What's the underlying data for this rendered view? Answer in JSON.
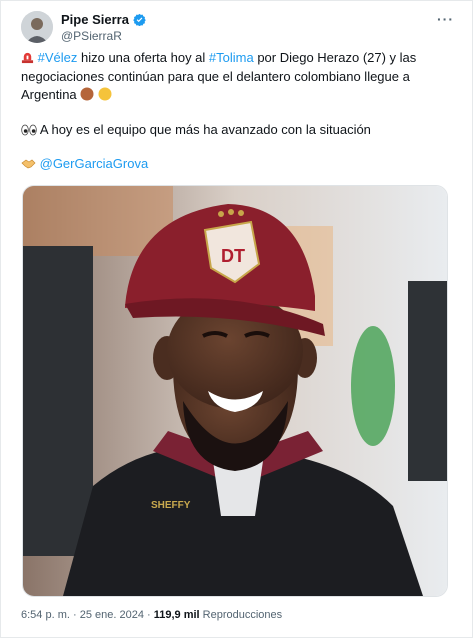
{
  "author": {
    "name": "Pipe Sierra",
    "handle": "@PSierraR"
  },
  "menu": {
    "more_label": "···"
  },
  "tweet": {
    "line1": {
      "hashtag1": "#Vélez",
      "text1": " hizo una oferta hoy al ",
      "hashtag2": "#Tolima",
      "text2": " por Diego Herazo (27) y las negociaciones continúan para que el delantero colombiano llegue a Argentina "
    },
    "line2": {
      "text": " A hoy es el equipo que más ha avanzado con la situación"
    },
    "line3": {
      "mention": "@GerGarciaGrova"
    }
  },
  "photo": {
    "cap_text": "DT",
    "jacket_text": "SHEFFY"
  },
  "meta": {
    "time": "6:54 p. m.",
    "sep1": " · ",
    "date": "25 ene. 2024",
    "sep2": " · ",
    "views": "119,9 mil",
    "views_label": " Reproducciones"
  },
  "colors": {
    "link": "#1d9bf0",
    "verified": "#1d9bf0",
    "cap": "#8a1f2c"
  }
}
